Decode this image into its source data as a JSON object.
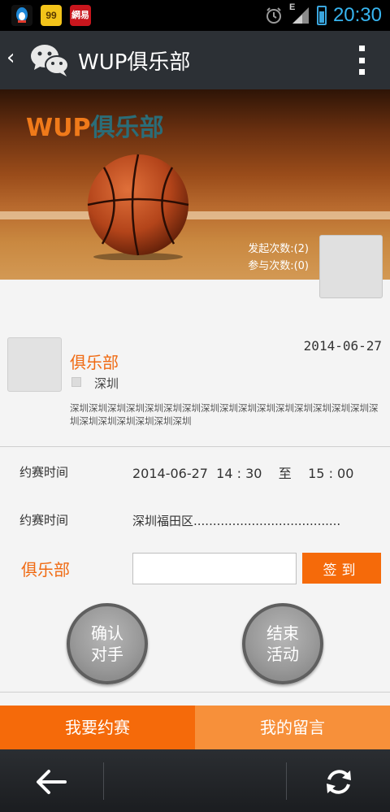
{
  "status_bar": {
    "time": "20:30",
    "network_label": "E",
    "notification_apps": [
      "qq-icon",
      "99-icon",
      "wangyi-icon"
    ],
    "notification_texts": {
      "app_99": "99",
      "app_wangyi": "網易"
    }
  },
  "title_bar": {
    "title": "WUP俱乐部"
  },
  "banner": {
    "title_part1": "WUP",
    "title_part2": "俱乐部",
    "launch_count": "发起次数:(2)",
    "join_count": "参与次数:(0)"
  },
  "club": {
    "name": "俱乐部",
    "date": "2014-06-27",
    "location": "深圳",
    "description": "深圳深圳深圳深圳深圳深圳深圳深圳深圳深圳深圳深圳深圳深圳深圳深圳深圳深圳深圳深圳深圳深圳深圳"
  },
  "match": {
    "time_label": "约赛时间",
    "time_value": "2014-06-27  14 : 30    至    15 : 00",
    "place_label": "约赛时间",
    "place_value": "深圳福田区......................................"
  },
  "checkin": {
    "label": "俱乐部",
    "input_value": "",
    "button_label": "签到"
  },
  "actions": {
    "confirm_line1": "确认",
    "confirm_line2": "对手",
    "end_line1": "结束",
    "end_line2": "活动"
  },
  "tabs": {
    "left": "我要约赛",
    "right": "我的留言"
  },
  "colors": {
    "accent_orange": "#f56a0a",
    "accent_orange_light": "#f7903a",
    "titlebar": "#2c3035",
    "status_clock": "#37b5f0"
  }
}
